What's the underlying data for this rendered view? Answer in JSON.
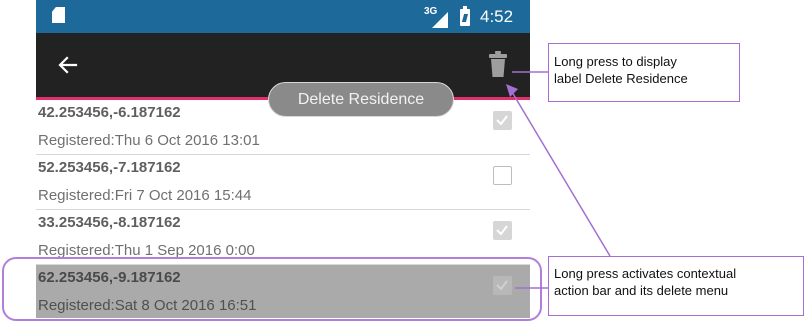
{
  "status_bar": {
    "network": "3G",
    "time": "4:52",
    "icons": [
      "sd-card-icon",
      "signal-icon",
      "battery-icon"
    ]
  },
  "action_bar": {
    "back_icon": "arrow-left-icon",
    "delete_icon": "trash-icon",
    "colors": {
      "background": "#222222",
      "accent": "#e0316a",
      "status_bar": "#1d6a9a"
    }
  },
  "tooltip": {
    "label": "Delete Residence"
  },
  "residences": [
    {
      "coords": "42.253456,-6.187162",
      "registered": "Registered:Thu 6 Oct 2016 13:01",
      "checked": true,
      "selected": false
    },
    {
      "coords": "52.253456,-7.187162",
      "registered": "Registered:Fri 7 Oct 2016 15:44",
      "checked": false,
      "selected": false
    },
    {
      "coords": "33.253456,-8.187162",
      "registered": "Registered:Thu 1 Sep 2016 0:00",
      "checked": true,
      "selected": false
    },
    {
      "coords": "62.253456,-9.187162",
      "registered": "Registered:Sat 8 Oct 2016 16:51",
      "checked": true,
      "selected": true
    }
  ],
  "annotations": {
    "top_line1": "Long press to display",
    "top_line2": "label Delete Residence",
    "bottom_line1": "Long press activates contextual",
    "bottom_line2": "action bar and its delete menu",
    "color": "#a46fd2"
  }
}
